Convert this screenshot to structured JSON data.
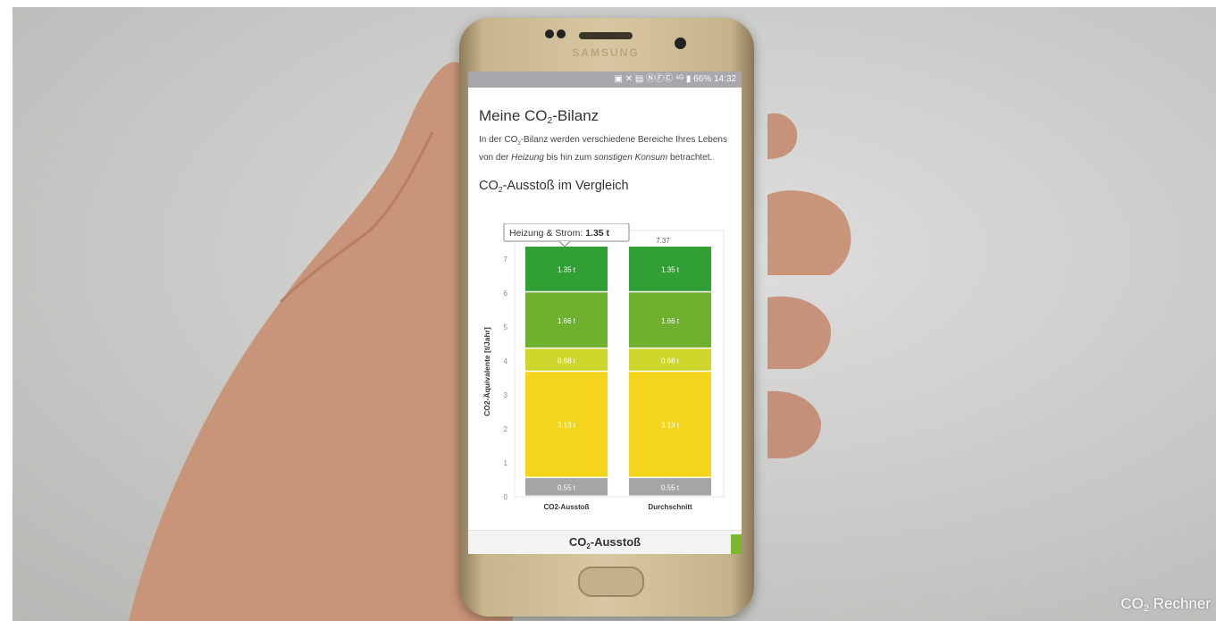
{
  "status": {
    "icons": "▣ ✕ ▤ ⓃⒻⒸ ⁴ᴳ ▮",
    "battery": "66%",
    "time": "14:32"
  },
  "page": {
    "title_a": "Meine CO",
    "title_sub": "2",
    "title_b": "-Bilanz",
    "desc_1": "In der CO",
    "desc_1_sub": "2",
    "desc_1b": "-Bilanz werden verschiedene Bereiche Ihres Lebens von der ",
    "desc_em1": "Heizung",
    "desc_2": " bis hin zum ",
    "desc_em2": "sonstigen Konsum",
    "desc_3": " betrachtet.",
    "section_a": "CO",
    "section_sub": "2",
    "section_b": "-Ausstoß im Vergleich"
  },
  "tooltip": {
    "label": "Heizung & Strom: ",
    "value": "1.35 t"
  },
  "footer": {
    "label_a": "CO",
    "label_sub": "2",
    "label_b": "-Ausstoß",
    "swatch": "#7cb82f"
  },
  "caption": {
    "a": "CO",
    "sub": "2",
    "b": " Rechner"
  },
  "brand": "SAMSUNG",
  "chart_data": {
    "type": "bar",
    "stacked": true,
    "categories": [
      "CO2-Ausstoß",
      "Durchschnitt"
    ],
    "ylabel": "CO2-Äquivalente [t/Jahr]",
    "ylim": [
      0,
      7.37
    ],
    "yticks": [
      0,
      1,
      2,
      3,
      4,
      5,
      6,
      7
    ],
    "total_label": "7.37",
    "series": [
      {
        "values": [
          0.55,
          0.55
        ],
        "labels": [
          "0.55 t",
          "0.55 t"
        ],
        "color": "#a7a4a6"
      },
      {
        "values": [
          3.13,
          3.13
        ],
        "labels": [
          "3.13 t",
          "3.13 t"
        ],
        "color": "#f5d51c"
      },
      {
        "values": [
          0.68,
          0.68
        ],
        "labels": [
          "0.68 t",
          "0.68 t"
        ],
        "color": "#cdd62b"
      },
      {
        "values": [
          1.66,
          1.66
        ],
        "labels": [
          "1.66 t",
          "1.66 t"
        ],
        "color": "#6fb12f"
      },
      {
        "values": [
          1.35,
          1.35
        ],
        "labels": [
          "1.35 t",
          "1.35 t"
        ],
        "color": "#31a034"
      }
    ]
  }
}
